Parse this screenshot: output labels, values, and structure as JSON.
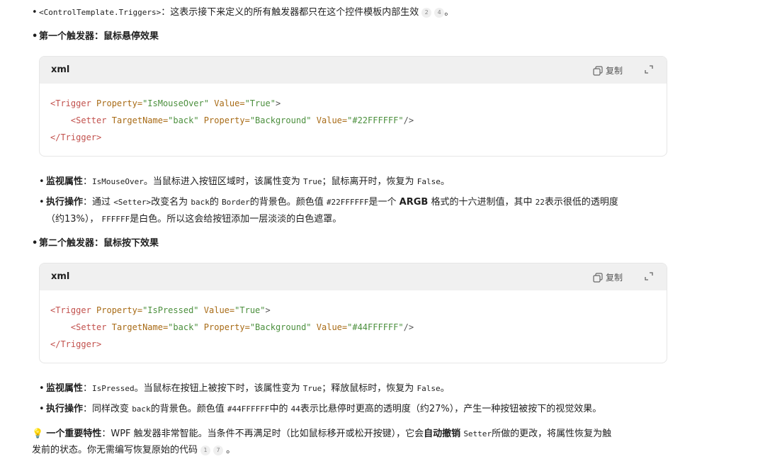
{
  "intro": {
    "code": "<ControlTemplate.Triggers>",
    "text": "：这表示接下来定义的所有触发器都只在这个控件模板内部生效",
    "cites": [
      "2",
      "4"
    ],
    "end": "。"
  },
  "trigger1": {
    "heading": "第一个触发器：鼠标悬停效果",
    "lang": "xml",
    "copy_label": "复制",
    "code": {
      "l1": {
        "open": "<Trigger",
        "a1": "Property=",
        "v1": "\"IsMouseOver\"",
        "a2": "Value=",
        "v2": "\"True\"",
        "close": ">"
      },
      "l2": {
        "indent": "    ",
        "open": "<Setter",
        "a1": "TargetName=",
        "v1": "\"back\"",
        "a2": "Property=",
        "v2": "\"Background\"",
        "a3": "Value=",
        "v3": "\"#22FFFFFF\"",
        "close": "/>"
      },
      "l3": "</Trigger>"
    },
    "monitor_label": "监视属性",
    "monitor_text": {
      "colon": "：",
      "code": "IsMouseOver",
      "t1": "。当鼠标进入按钮区域时，该属性变为",
      "code2": "True",
      "t2": "；鼠标离开时，恢复为",
      "code3": "False",
      "t3": "。"
    },
    "action_label": "执行操作",
    "action_text": {
      "colon": "：",
      "t1": "通过",
      "code": "<Setter>",
      "t2": "改变名为",
      "code2": "back",
      "t3": "的",
      "code3": "Border",
      "t4": "的背景色。颜色值",
      "code4": "#22FFFFFF",
      "t5": "是一个",
      "bold": "ARGB",
      "t6": "格式的十六进制值，其中",
      "code5": "22",
      "t7": "表示很低的透明度",
      "l2_t1": "（约13%），",
      "l2_code": "FFFFFF",
      "l2_t2": "是白色。所以这会给按钮添加一层淡淡的白色遮罩。"
    }
  },
  "trigger2": {
    "heading": "第二个触发器：鼠标按下效果",
    "lang": "xml",
    "copy_label": "复制",
    "code": {
      "l1": {
        "open": "<Trigger",
        "a1": "Property=",
        "v1": "\"IsPressed\"",
        "a2": "Value=",
        "v2": "\"True\"",
        "close": ">"
      },
      "l2": {
        "indent": "    ",
        "open": "<Setter",
        "a1": "TargetName=",
        "v1": "\"back\"",
        "a2": "Property=",
        "v2": "\"Background\"",
        "a3": "Value=",
        "v3": "\"#44FFFFFF\"",
        "close": "/>"
      },
      "l3": "</Trigger>"
    },
    "monitor_label": "监视属性",
    "monitor_text": {
      "colon": "：",
      "code": "IsPressed",
      "t1": "。当鼠标在按钮上被按下时，该属性变为",
      "code2": "True",
      "t2": "；释放鼠标时，恢复为",
      "code3": "False",
      "t3": "。"
    },
    "action_label": "执行操作",
    "action_text": {
      "colon": "：",
      "t1": "同样改变",
      "code": "back",
      "t2": "的背景色。颜色值",
      "code2": "#44FFFFFF",
      "t3": "中的",
      "code3": "44",
      "t4": "表示比悬停时更高的透明度（约27%），产生一种按钮被按下的视觉效果。"
    }
  },
  "note": {
    "icon": "💡",
    "bold": "一个重要特性",
    "t1": "：WPF 触发器非常智能。当条件不再满足时（比如鼠标移开或松开按键），它会",
    "bold2": "自动撤销",
    "code": "Setter",
    "t2": "所做的更改，将属性恢复为触",
    "l2": "发前的状态。你无需编写恢复原始的代码",
    "cites": [
      "1",
      "7"
    ],
    "end": "。"
  },
  "bullet": "•"
}
